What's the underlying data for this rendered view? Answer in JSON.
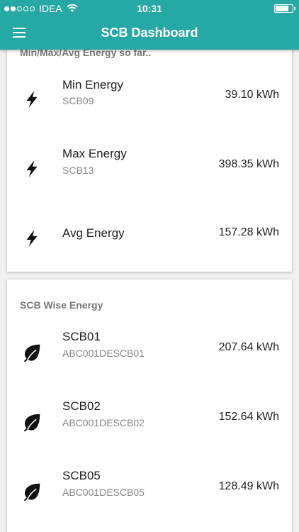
{
  "status": {
    "carrier": "IDEA",
    "time": "10:31"
  },
  "header": {
    "title": "SCB Dashboard"
  },
  "summary": {
    "heading": "Min/Max/Avg Energy so far..",
    "items": [
      {
        "title": "Min Energy",
        "subtitle": "SCB09",
        "value": "39.10 kWh"
      },
      {
        "title": "Max Energy",
        "subtitle": "SCB13",
        "value": "398.35 kWh"
      },
      {
        "title": "Avg Energy",
        "value": "157.28 kWh"
      }
    ]
  },
  "scb_wise": {
    "heading": "SCB Wise Energy",
    "items": [
      {
        "title": "SCB01",
        "subtitle": "ABC001DESCB01",
        "value": "207.64 kWh"
      },
      {
        "title": "SCB02",
        "subtitle": "ABC001DESCB02",
        "value": "152.64 kWh"
      },
      {
        "title": "SCB05",
        "subtitle": "ABC001DESCB05",
        "value": "128.49 kWh"
      }
    ]
  },
  "colors": {
    "primary": "#26a9a5"
  }
}
